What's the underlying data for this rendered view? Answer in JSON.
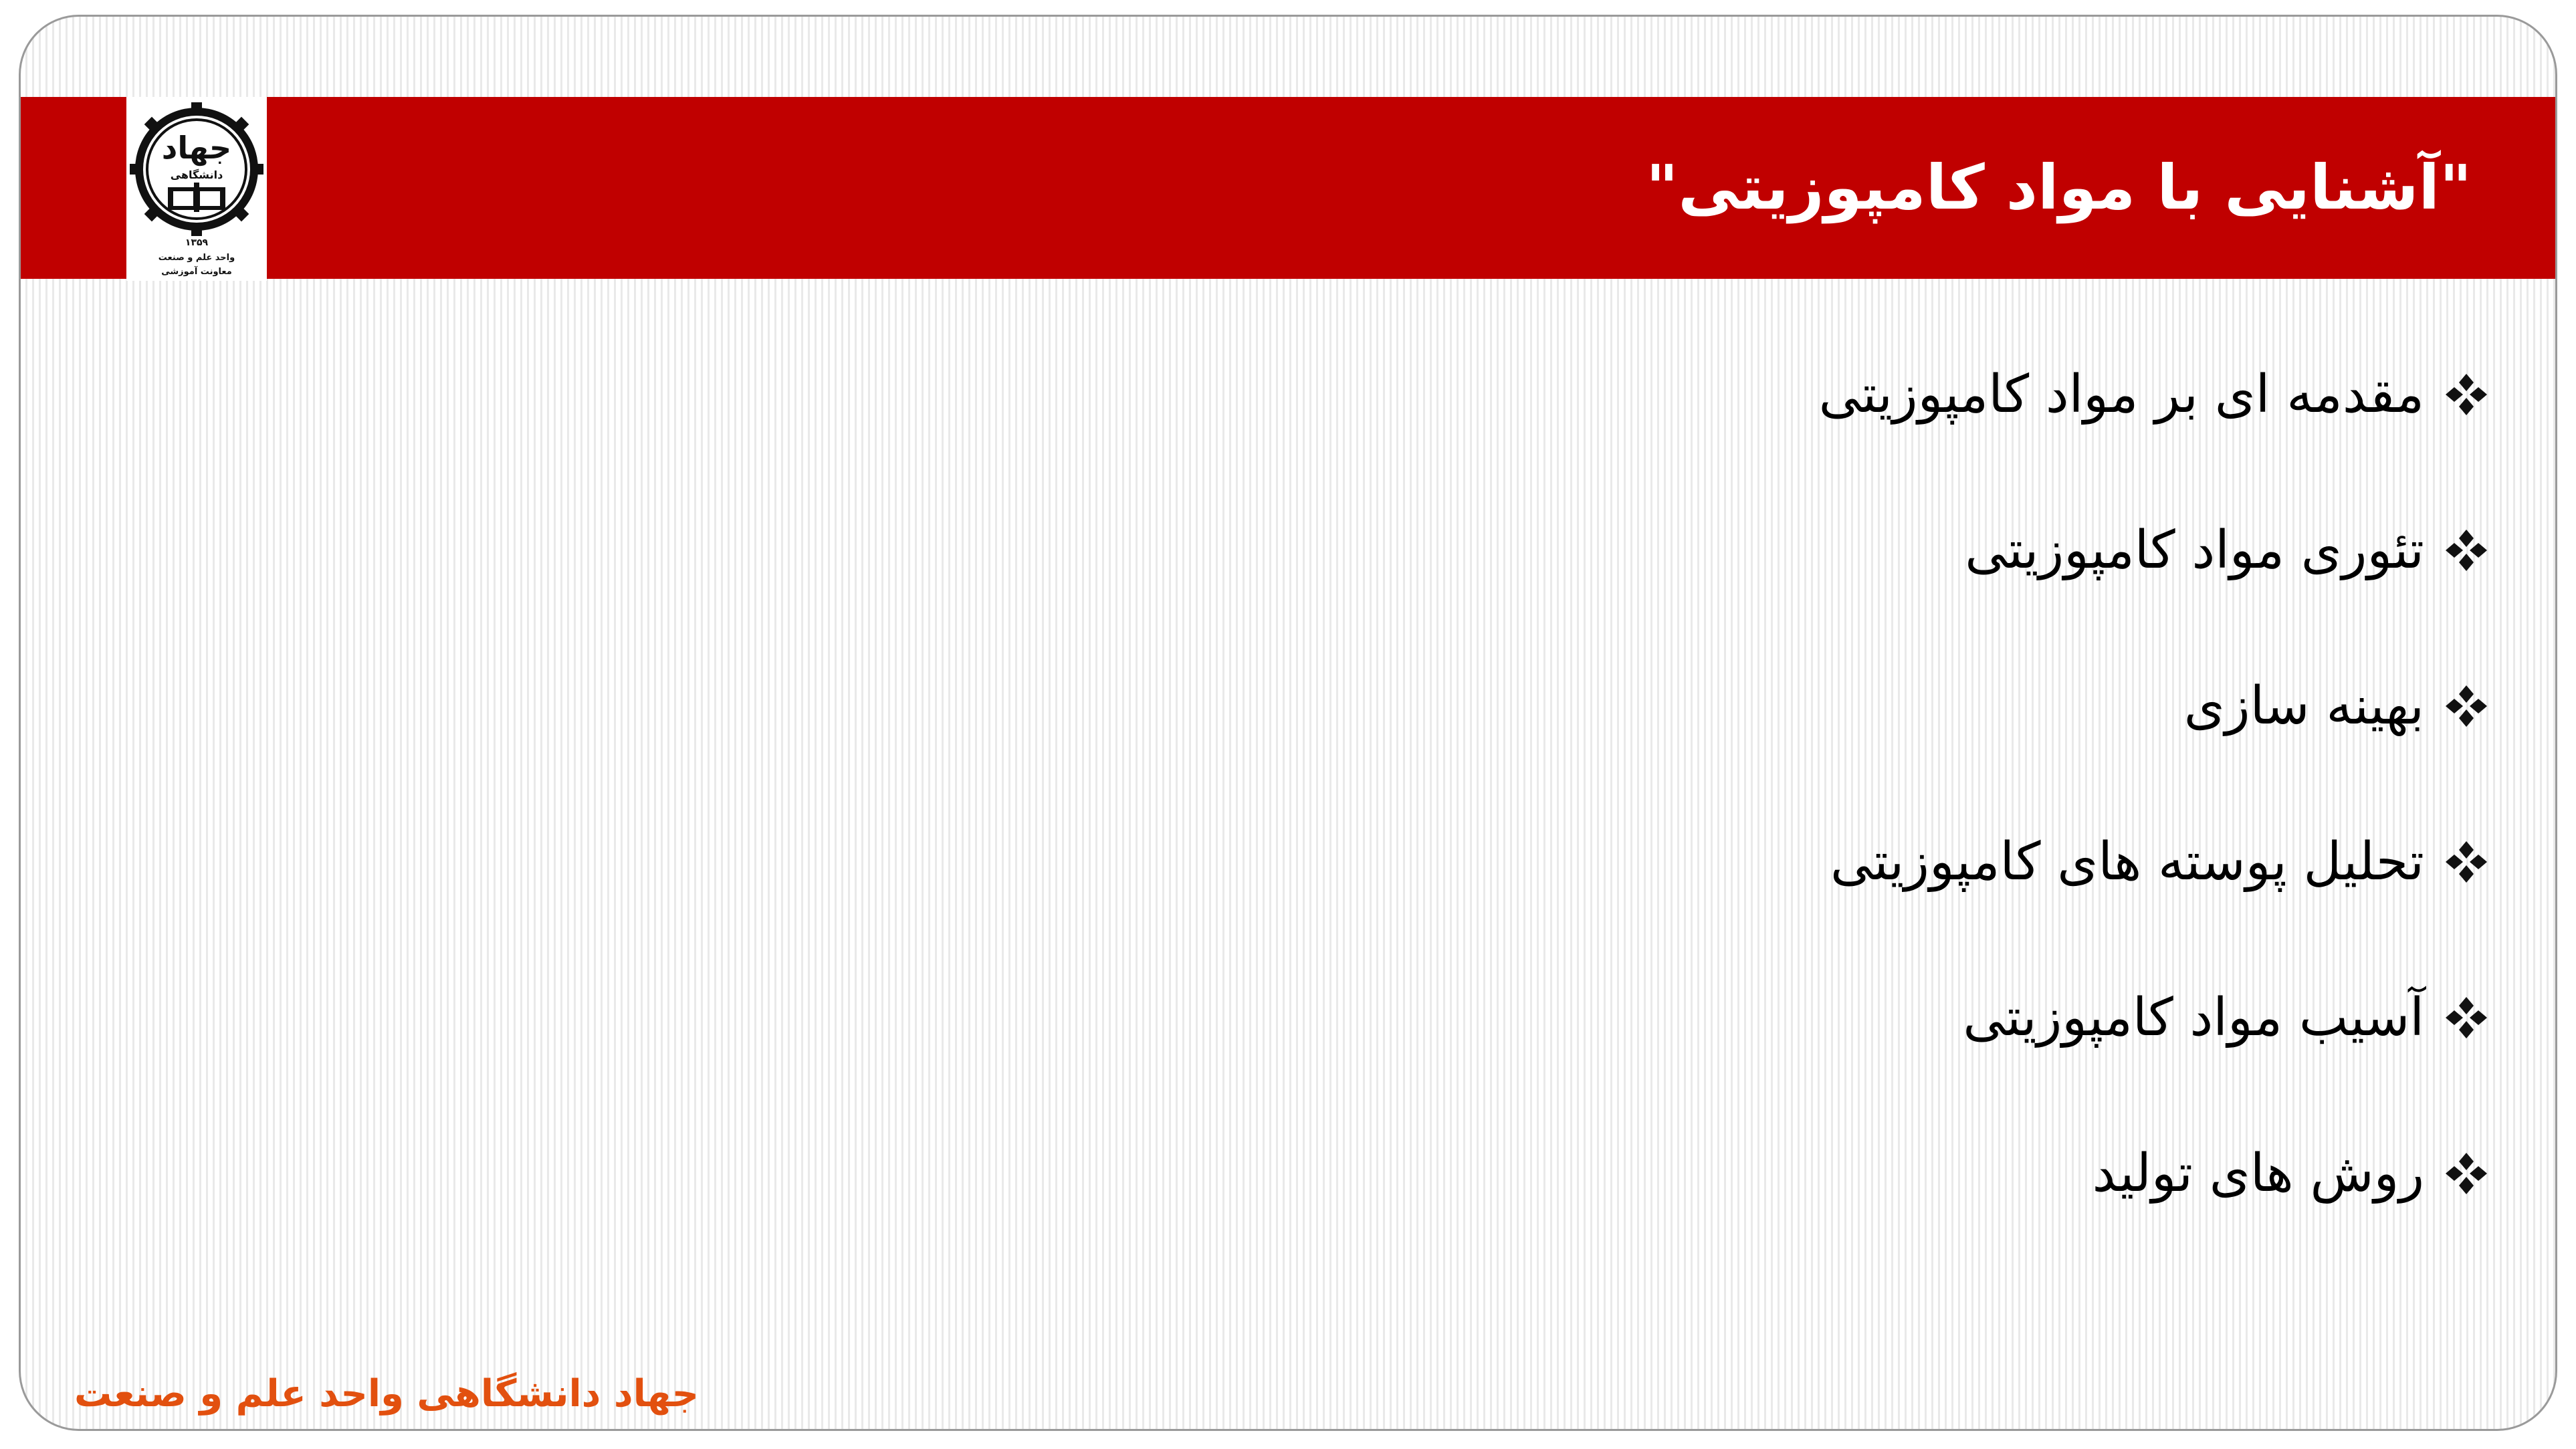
{
  "slide": {
    "title": "\"آشنایی با مواد کامپوزیتی\"",
    "logo": {
      "name": "jahad-daneshgahi-logo",
      "text_main": "جهاد",
      "text_sub": "دانشگاهی",
      "year": "۱۳۵۹",
      "unit": "واحد علم و صنعت",
      "department": "معاونت آموزشی"
    },
    "bullets": [
      {
        "icon": "four-diamond-bullet-icon",
        "label": "مقدمه ای بر مواد کامپوزیتی"
      },
      {
        "icon": "four-diamond-bullet-icon",
        "label": "تئوری مواد کامپوزیتی"
      },
      {
        "icon": "four-diamond-bullet-icon",
        "label": "بهینه سازی"
      },
      {
        "icon": "four-diamond-bullet-icon",
        "label": "تحلیل پوسته های کامپوزیتی"
      },
      {
        "icon": "four-diamond-bullet-icon",
        "label": "آسیب مواد کامپوزیتی"
      },
      {
        "icon": "four-diamond-bullet-icon",
        "label": "روش های تولید"
      }
    ],
    "footer": "جهاد دانشگاهی واحد علم و صنعت",
    "colors": {
      "title_bar": "#c00000",
      "title_text": "#ffffff",
      "footer_text": "#e2500f",
      "body_text": "#000000"
    }
  }
}
